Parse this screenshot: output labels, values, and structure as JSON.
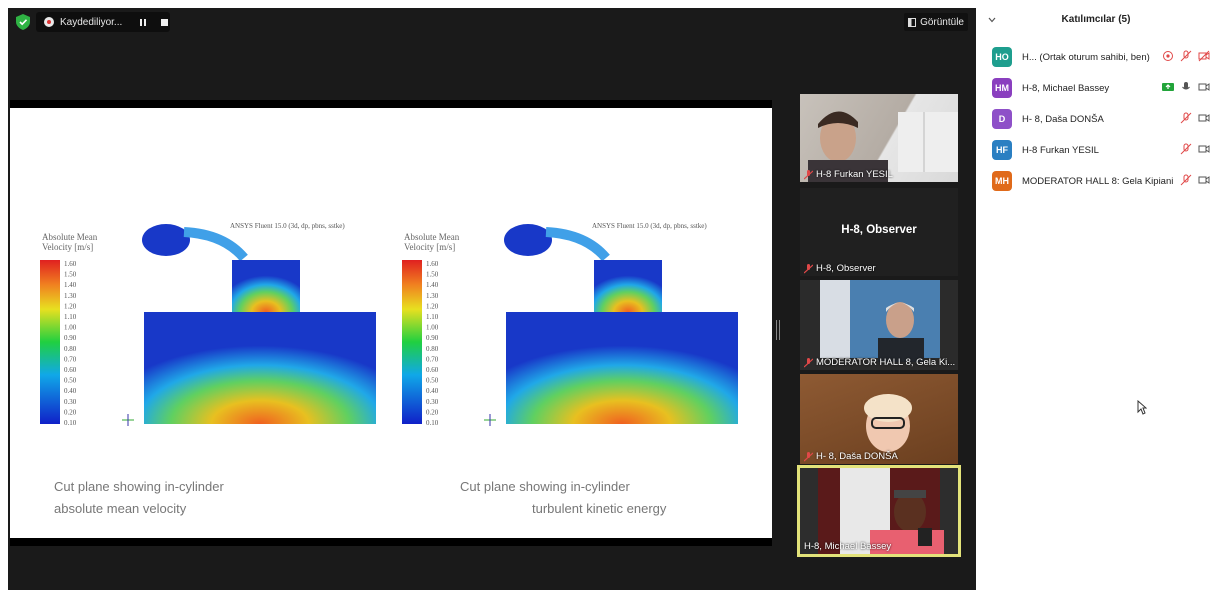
{
  "topbar": {
    "recording_label": "Kaydediliyor...",
    "view_label": "Görüntüle"
  },
  "slide": {
    "caption_left_line1": "Cut plane showing in-cylinder",
    "caption_left_line2": "absolute mean velocity",
    "caption_right_line1": "Cut plane showing in-cylinder",
    "caption_right_line2": "turbulent kinetic energy",
    "plot_left": {
      "header": "ANSYS Fluent 15.0 (3d, dp, pbns, sstke)",
      "legend_title_1": "Absolute Mean",
      "legend_title_2": "Velocity [m/s]",
      "legend_values": [
        "1.60",
        "1.50",
        "1.40",
        "1.30",
        "1.20",
        "1.10",
        "1.00",
        "0.90",
        "0.80",
        "0.70",
        "0.60",
        "0.50",
        "0.40",
        "0.30",
        "0.20",
        "0.10"
      ]
    },
    "plot_right": {
      "header": "ANSYS Fluent 15.0 (3d, dp, pbns, sstke)",
      "legend_title_1": "Absolute Mean",
      "legend_title_2": "Velocity [m/s]",
      "legend_values": [
        "1.60",
        "1.50",
        "1.40",
        "1.30",
        "1.20",
        "1.10",
        "1.00",
        "0.90",
        "0.80",
        "0.70",
        "0.60",
        "0.50",
        "0.40",
        "0.30",
        "0.20",
        "0.10"
      ]
    }
  },
  "tiles": [
    {
      "name": "H-8 Furkan YESIL"
    },
    {
      "name": "H-8, Observer",
      "center": "H-8, Observer"
    },
    {
      "name": "MODERATOR HALL 8, Gela Ki..."
    },
    {
      "name": "H- 8, Daša DONŠA"
    },
    {
      "name": "H-8, Michael Bassey"
    }
  ],
  "panel": {
    "title": "Katılımcılar (5)",
    "participants": [
      {
        "initials": "HO",
        "name": "H... (Ortak oturum sahibi, ben)",
        "color": "#1e9e8e"
      },
      {
        "initials": "HM",
        "name": "H-8, Michael Bassey",
        "color": "#8a3fbf"
      },
      {
        "initials": "D",
        "name": "H- 8, Daša DONŠA",
        "color": "#8e50c8"
      },
      {
        "initials": "HF",
        "name": "H-8 Furkan YESIL",
        "color": "#2a7fc2"
      },
      {
        "initials": "MH",
        "name": "MODERATOR HALL 8: Gela Kipiani",
        "color": "#e06a1a"
      }
    ]
  },
  "colors": {
    "meeting_bg": "#1a1a1a",
    "active_speaker_border": "#e3e37a",
    "muted_icon": "#e04848",
    "share_badge": "#22a43a"
  }
}
